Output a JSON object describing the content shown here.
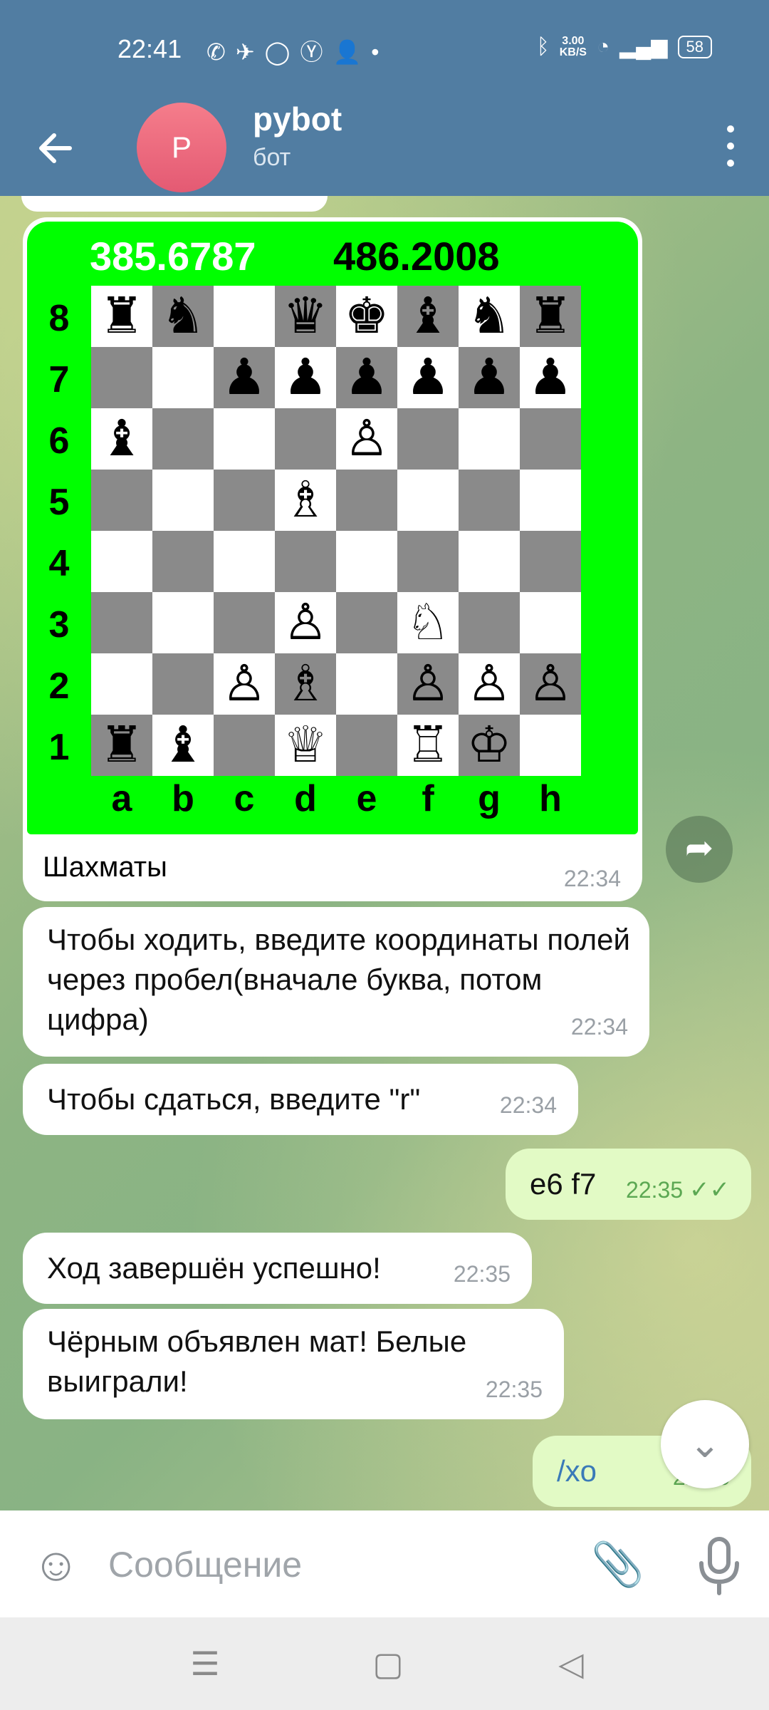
{
  "status_bar": {
    "time": "22:41",
    "net_speed_value": "3.00",
    "net_speed_unit": "KB/S",
    "battery": "58"
  },
  "header": {
    "avatar_letter": "P",
    "title": "pybot",
    "subtitle": "бот"
  },
  "chess_message": {
    "score_white": "385.6787",
    "score_black": "486.2008",
    "ranks": [
      "8",
      "7",
      "6",
      "5",
      "4",
      "3",
      "2",
      "1"
    ],
    "files": [
      "a",
      "b",
      "c",
      "d",
      "e",
      "f",
      "g",
      "h"
    ],
    "board": [
      [
        "♜",
        "♞",
        "",
        "♛",
        "♚",
        "♝",
        "♞",
        "♜"
      ],
      [
        "",
        "",
        "♟",
        "♟",
        "♟",
        "♟",
        "♟",
        "♟"
      ],
      [
        "♝",
        "",
        "",
        "",
        "♙",
        "",
        "",
        ""
      ],
      [
        "",
        "",
        "",
        "♗",
        "",
        "",
        "",
        ""
      ],
      [
        "",
        "",
        "",
        "",
        "",
        "",
        "",
        ""
      ],
      [
        "",
        "",
        "",
        "♙",
        "",
        "♘",
        "",
        ""
      ],
      [
        "",
        "",
        "♙",
        "♗",
        "",
        "♙",
        "♙",
        "♙"
      ],
      [
        "♜",
        "♝",
        "",
        "♕",
        "",
        "♖",
        "♔",
        ""
      ]
    ],
    "caption": "Шахматы",
    "time": "22:34"
  },
  "messages": [
    {
      "direction": "in",
      "text": "Чтобы ходить, введите координаты полей через пробел(вначале буква, потом цифра)",
      "time": "22:34"
    },
    {
      "direction": "in",
      "text": "Чтобы сдаться, введите \"r\"",
      "time": "22:34"
    },
    {
      "direction": "out",
      "text": "e6 f7",
      "time": "22:35"
    },
    {
      "direction": "in",
      "text": "Ход завершён успешно!",
      "time": "22:35"
    },
    {
      "direction": "in",
      "text": "Чёрным объявлен мат! Белые выиграли!",
      "time": "22:35"
    },
    {
      "direction": "out",
      "text": "/xo",
      "time": "22:35"
    }
  ],
  "input": {
    "placeholder": "Сообщение"
  },
  "icons": {
    "back": "arrow-left-icon",
    "menu": "more-vertical-icon",
    "share": "share-icon",
    "emoji": "emoji-icon",
    "attach": "paperclip-icon",
    "mic": "microphone-icon",
    "scroll_down": "chevron-down-icon"
  },
  "colors": {
    "header": "#517da2",
    "board_bg": "#00ff00",
    "outgoing_bubble": "#e2fac5",
    "incoming_bubble": "#ffffff"
  }
}
